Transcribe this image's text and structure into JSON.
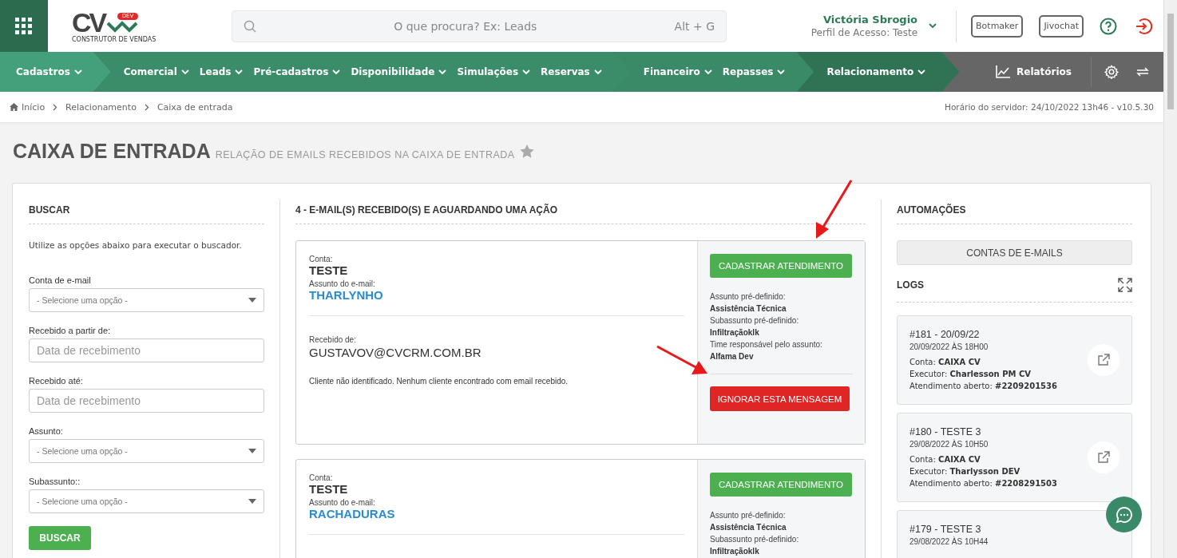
{
  "header": {
    "logo_text": "CV",
    "logo_badge": "DEV",
    "logo_tagline": "CONSTRUTOR DE VENDAS",
    "search": {
      "placeholder": "O que procura? Ex: Leads",
      "shortcut": "Alt + G"
    },
    "user": {
      "name": "Victória Sbrogio",
      "profile": "Perfil de Acesso: Teste"
    },
    "buttons": [
      "Botmaker",
      "Jivochat"
    ]
  },
  "nav": {
    "groups": [
      {
        "selected": false,
        "items": [
          "Cadastros"
        ]
      },
      {
        "selected": false,
        "items": [
          "Comercial",
          "Leads",
          "Pré-cadastros",
          "Disponibilidade",
          "Simulações",
          "Reservas"
        ]
      },
      {
        "selected": false,
        "items": [
          "Financeiro",
          "Repasses"
        ]
      },
      {
        "selected": true,
        "items": [
          "Relacionamento"
        ]
      }
    ],
    "reports": "Relatórios"
  },
  "breadcrumb": {
    "items": [
      "Início",
      "Relacionamento",
      "Caixa de entrada"
    ],
    "server_time": "Horário do servidor: 24/10/2022 13h46 - v10.5.30"
  },
  "page": {
    "title": "CAIXA DE ENTRADA",
    "subtitle": "RELAÇÃO DE EMAILS RECEBIDOS NA CAIXA DE ENTRADA",
    "favorite": false
  },
  "search_panel": {
    "title": "BUSCAR",
    "hint": "Utilize as opções abaixo para executar o buscador.",
    "fields": [
      {
        "kind": "select",
        "label": "Conta de e-mail",
        "placeholder": "- Selecione uma opção -"
      },
      {
        "kind": "input",
        "label": "Recebido a partir de:",
        "placeholder": "Data de recebimento"
      },
      {
        "kind": "input",
        "label": "Recebido até:",
        "placeholder": "Data de recebimento"
      },
      {
        "kind": "select",
        "label": "Assunto:",
        "placeholder": "- Selecione uma opção -"
      },
      {
        "kind": "select",
        "label": "Subassunto::",
        "placeholder": "- Selecione uma opção -"
      }
    ],
    "button": "BUSCAR"
  },
  "inbox": {
    "title": "4 - E-MAIL(S) RECEBIDO(S) E AGUARDANDO UMA AÇÃO",
    "emails": [
      {
        "account_label": "Conta:",
        "account": "TESTE",
        "subject_label": "Assunto do e-mail:",
        "subject": "THARLYNHO",
        "from_label": "Recebido de:",
        "from": "GUSTAVOV@CVCRM.COM.BR",
        "note": "Cliente não identificado. Nenhum cliente encontrado com email recebido.",
        "register_button": "CADASTRAR ATENDIMENTO",
        "details": [
          {
            "label": "Assunto pré-definido:",
            "value": "Assistência Técnica"
          },
          {
            "label": "Subassunto pré-definido:",
            "value": "Infiltraçãoklk"
          },
          {
            "label": "Time responsável pelo assunto:",
            "value": "Alfama Dev"
          }
        ],
        "ignore_button": "IGNORAR ESTA MENSAGEM"
      },
      {
        "account_label": "Conta:",
        "account": "TESTE",
        "subject_label": "Assunto do e-mail:",
        "subject": "RACHADURAS",
        "register_button": "CADASTRAR ATENDIMENTO",
        "details": [
          {
            "label": "Assunto pré-definido:",
            "value": "Assistência Técnica"
          },
          {
            "label": "Subassunto pré-definido:",
            "value": "Infiltraçãoklk"
          }
        ]
      }
    ]
  },
  "automations": {
    "title": "AUTOMAÇÕES",
    "accounts_button": "CONTAS DE E-MAILS",
    "logs_title": "LOGS",
    "logs": [
      {
        "title": "#181 - 20/09/22",
        "date": "20/09/2022 ÀS 18H00",
        "fields": [
          {
            "label": "Conta:",
            "value": "CAIXA CV"
          },
          {
            "label": "Executor:",
            "value": "Charlesson PM CV"
          },
          {
            "label": "Atendimento aberto:",
            "value": "#2209201536"
          }
        ]
      },
      {
        "title": "#180 - TESTE 3",
        "date": "29/08/2022 ÀS 10H50",
        "fields": [
          {
            "label": "Conta:",
            "value": "CAIXA CV"
          },
          {
            "label": "Executor:",
            "value": "Tharlysson DEV"
          },
          {
            "label": "Atendimento aberto:",
            "value": "#2208291503"
          }
        ]
      },
      {
        "title": "#179 - TESTE 3",
        "date": "29/08/2022 ÀS 10H44"
      }
    ]
  }
}
